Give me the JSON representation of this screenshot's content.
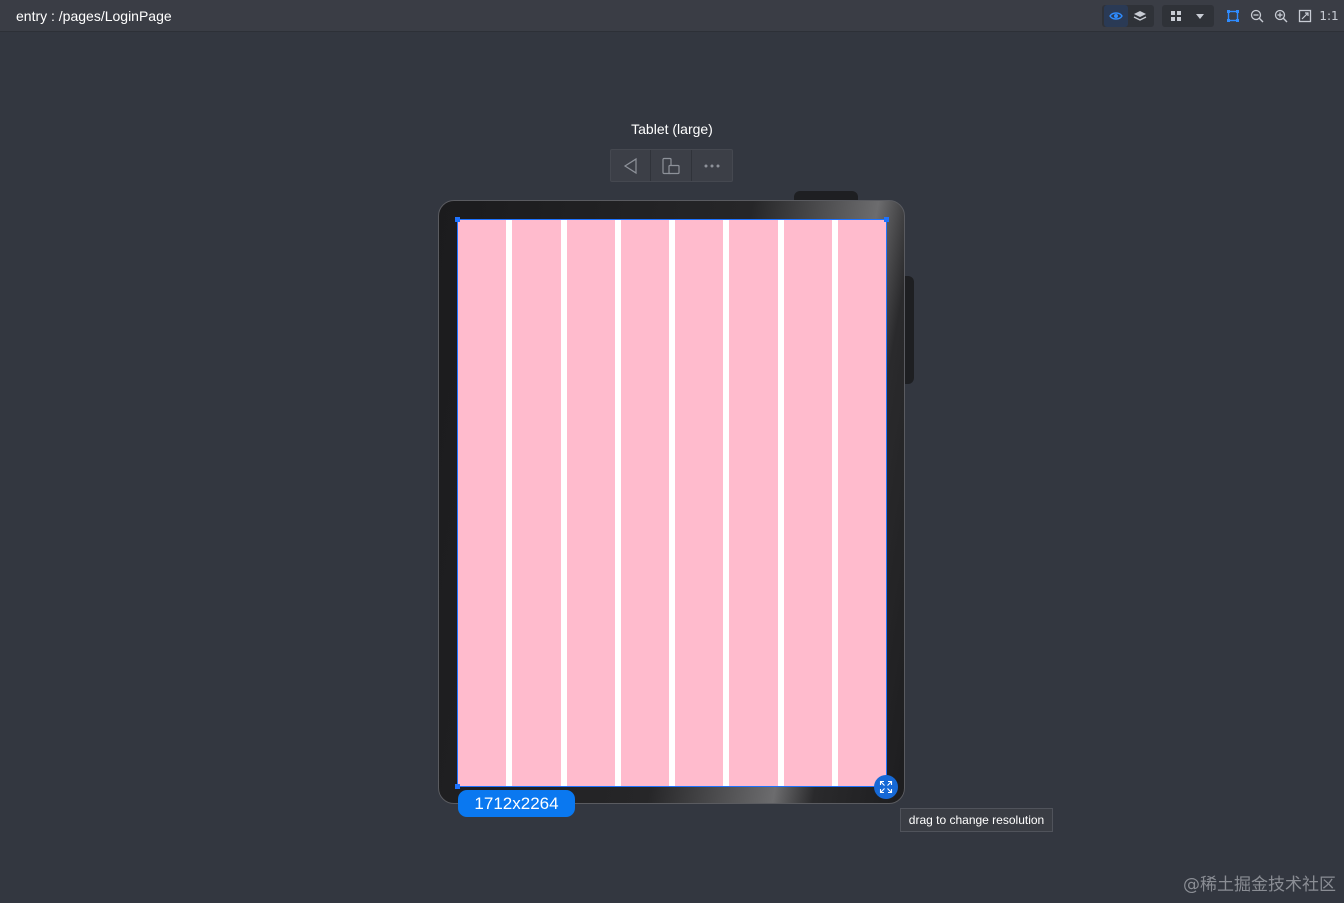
{
  "header": {
    "title": "entry : /pages/LoginPage"
  },
  "toolbar": {
    "icons": [
      "eye-icon",
      "layers-icon",
      "grid-icon",
      "dropdown-icon",
      "selection-frame-icon",
      "zoom-out-icon",
      "zoom-in-icon",
      "fit-screen-icon"
    ],
    "ratio_label": "1:1",
    "accent": "#1e73ff"
  },
  "device": {
    "name": "Tablet (large)",
    "resolution": "1712x2264",
    "tooltip": "drag to change resolution",
    "screen_columns": 8,
    "column_color": "#ffbbcd"
  },
  "device_toolbar": {
    "icons": [
      "rotate-back-icon",
      "device-switch-icon",
      "more-icon"
    ]
  },
  "watermark": "@稀土掘金技术社区"
}
